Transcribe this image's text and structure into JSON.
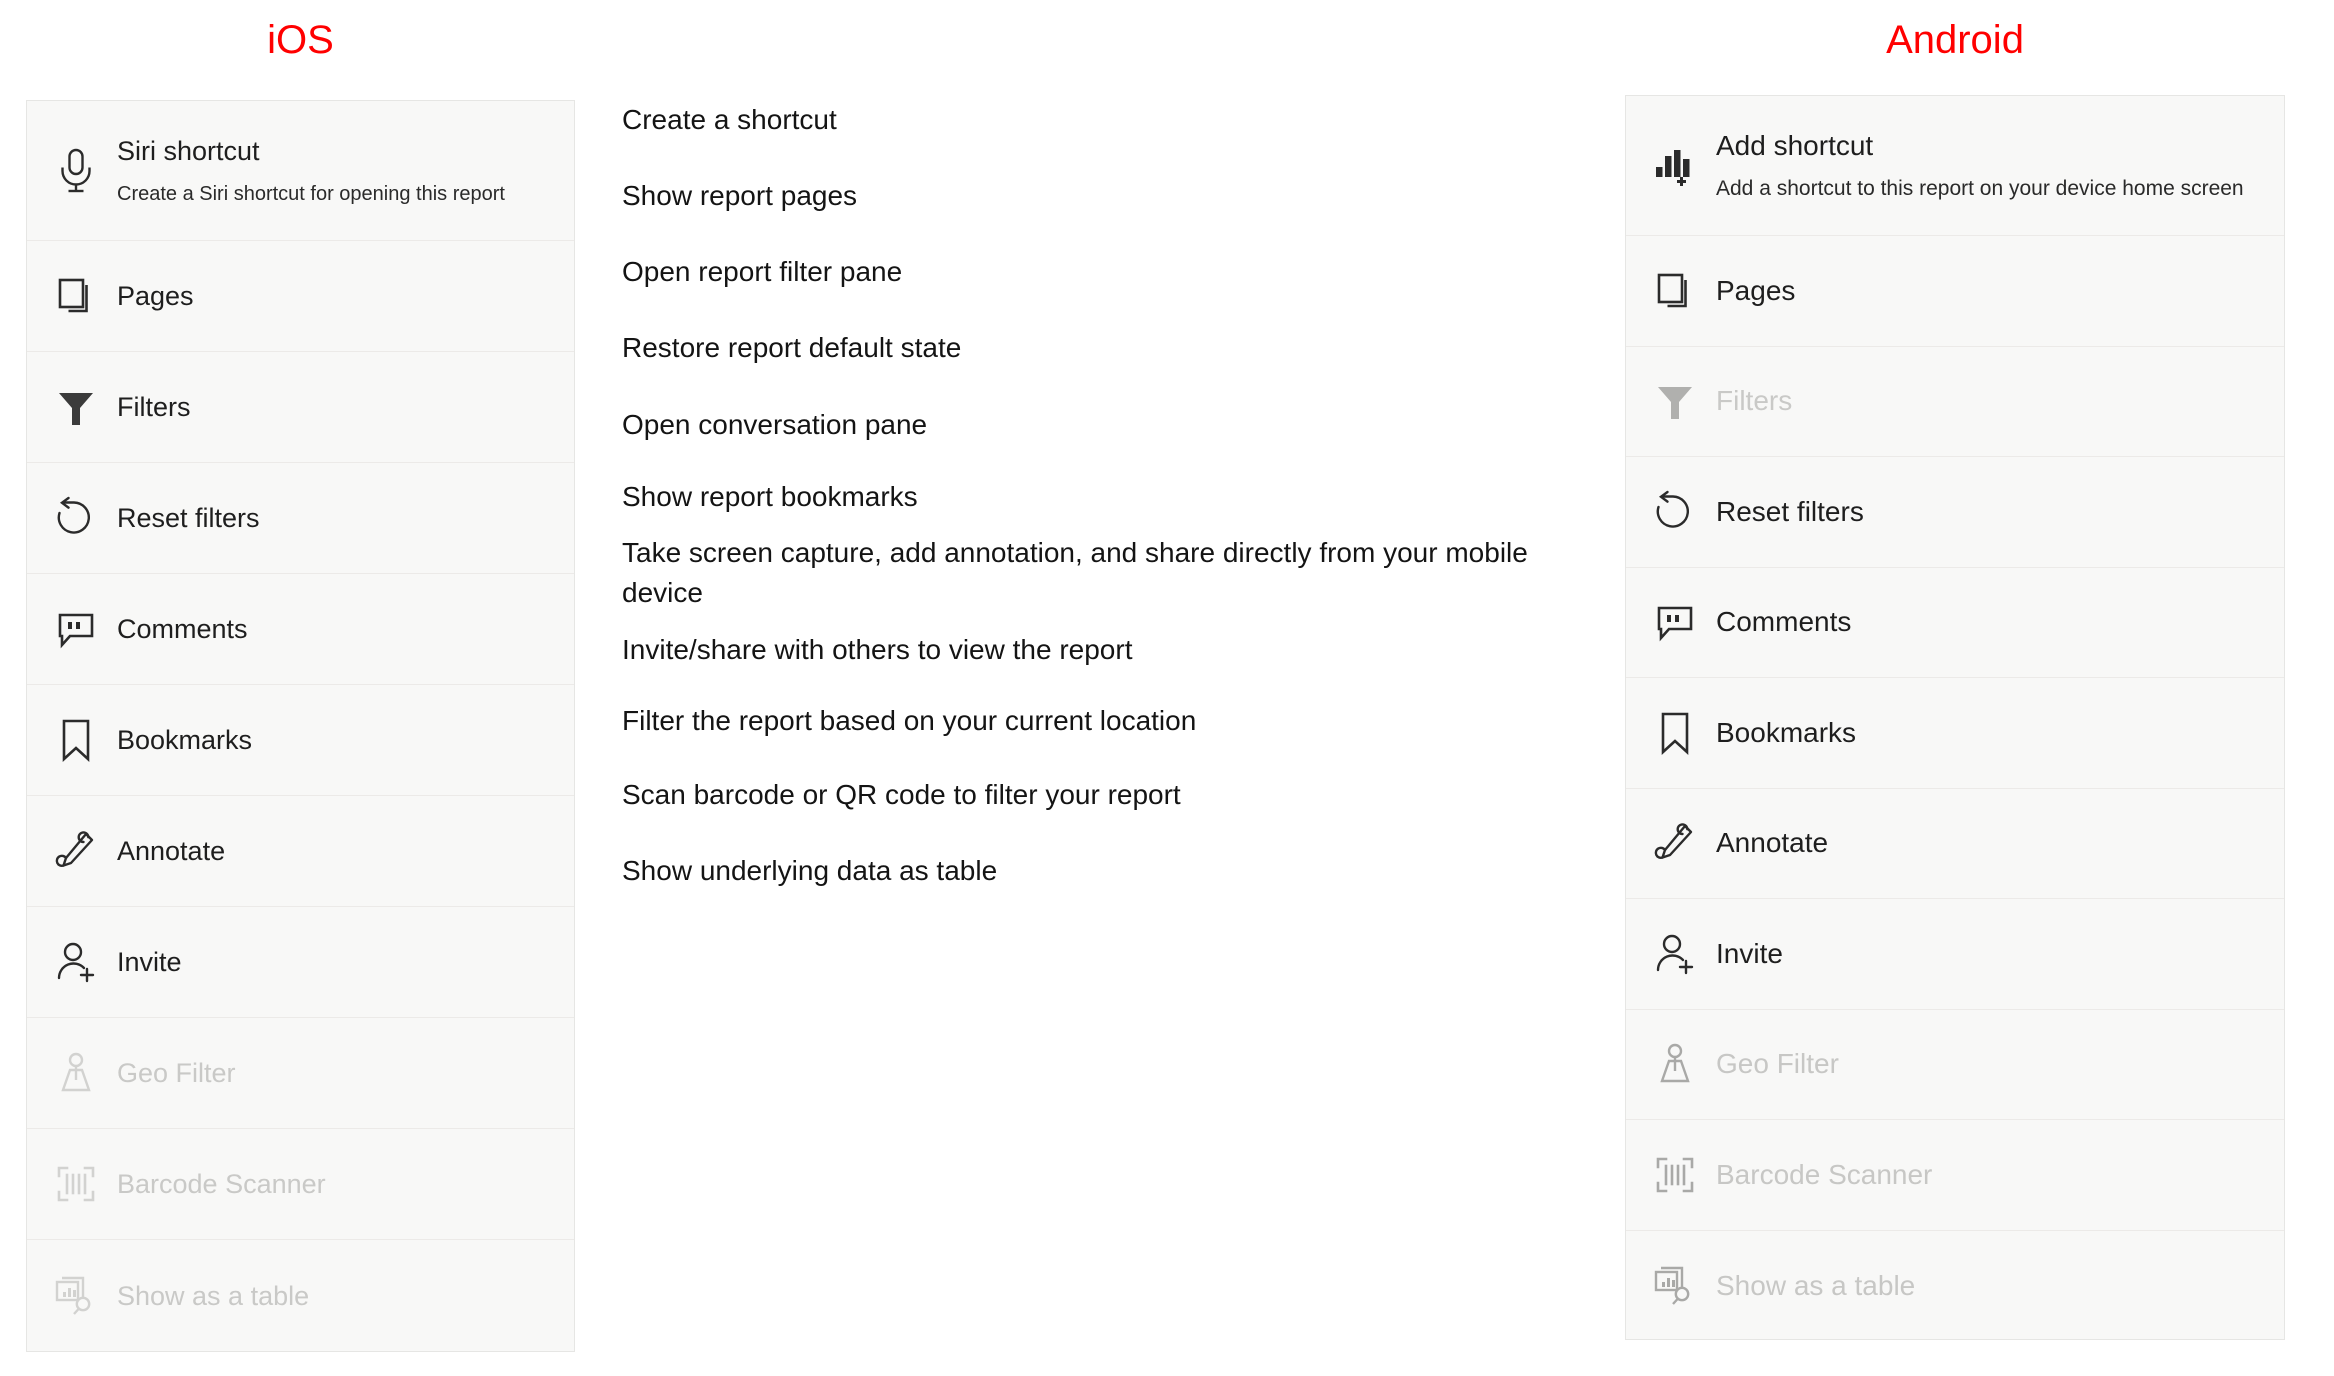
{
  "headers": {
    "ios": "iOS",
    "android": "Android",
    "accent_color": "#ff0000"
  },
  "ios_panel": {
    "items": [
      {
        "icon": "microphone-icon",
        "label": "Siri shortcut",
        "sublabel": "Create a Siri shortcut for opening this report",
        "disabled": false
      },
      {
        "icon": "pages-icon",
        "label": "Pages",
        "sublabel": "",
        "disabled": false
      },
      {
        "icon": "funnel-filter-icon",
        "label": "Filters",
        "sublabel": "",
        "disabled": false
      },
      {
        "icon": "reset-undo-icon",
        "label": "Reset filters",
        "sublabel": "",
        "disabled": false
      },
      {
        "icon": "comment-bubble-icon",
        "label": "Comments",
        "sublabel": "",
        "disabled": false
      },
      {
        "icon": "bookmark-icon",
        "label": "Bookmarks",
        "sublabel": "",
        "disabled": false
      },
      {
        "icon": "annotate-pen-icon",
        "label": "Annotate",
        "sublabel": "",
        "disabled": false
      },
      {
        "icon": "person-add-icon",
        "label": "Invite",
        "sublabel": "",
        "disabled": false
      },
      {
        "icon": "geo-filter-icon",
        "label": "Geo Filter",
        "sublabel": "",
        "disabled": true
      },
      {
        "icon": "barcode-scanner-icon",
        "label": "Barcode Scanner",
        "sublabel": "",
        "disabled": true
      },
      {
        "icon": "show-as-table-icon",
        "label": "Show as a table",
        "sublabel": "",
        "disabled": true
      }
    ]
  },
  "android_panel": {
    "items": [
      {
        "icon": "bar-chart-add-icon",
        "label": "Add shortcut",
        "sublabel": "Add a shortcut to this report on your device home screen",
        "disabled": false
      },
      {
        "icon": "pages-icon",
        "label": "Pages",
        "sublabel": "",
        "disabled": false
      },
      {
        "icon": "funnel-filter-icon",
        "label": "Filters",
        "sublabel": "",
        "disabled": true
      },
      {
        "icon": "reset-undo-icon",
        "label": "Reset filters",
        "sublabel": "",
        "disabled": false
      },
      {
        "icon": "comment-bubble-icon",
        "label": "Comments",
        "sublabel": "",
        "disabled": false
      },
      {
        "icon": "bookmark-icon",
        "label": "Bookmarks",
        "sublabel": "",
        "disabled": false
      },
      {
        "icon": "annotate-pen-icon",
        "label": "Annotate",
        "sublabel": "",
        "disabled": false
      },
      {
        "icon": "person-add-icon",
        "label": "Invite",
        "sublabel": "",
        "disabled": false
      },
      {
        "icon": "geo-filter-icon",
        "label": "Geo Filter",
        "sublabel": "",
        "disabled": true
      },
      {
        "icon": "barcode-scanner-icon",
        "label": "Barcode Scanner",
        "sublabel": "",
        "disabled": true
      },
      {
        "icon": "show-as-table-icon",
        "label": "Show as a table",
        "sublabel": "",
        "disabled": true
      }
    ]
  },
  "descriptions": [
    "Create a shortcut",
    "Show report pages",
    "Open report filter pane",
    "Restore report default state",
    "Open conversation pane",
    "Show report bookmarks",
    "Take screen capture, add annotation, and share directly from your mobile device",
    "Invite/share with others to view the report",
    "Filter the report based on your current location",
    "Scan barcode or QR code to filter your report",
    "Show underlying data as table"
  ]
}
